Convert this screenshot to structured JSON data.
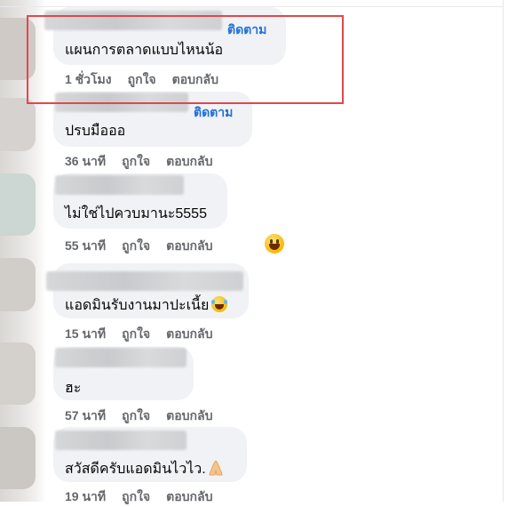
{
  "comments": [
    {
      "follow": "ติดตาม",
      "text": "แผนการตลาดแบบไหนน้อ",
      "time": "1 ชั่วโมง",
      "like": "ถูกใจ",
      "reply": "ตอบกลับ"
    },
    {
      "follow": "ติดตาม",
      "text": "ปรบมือออ",
      "time": "36 นาที",
      "like": "ถูกใจ",
      "reply": "ตอบกลับ"
    },
    {
      "text": "ไม่ใช่ไปควบมานะ5555",
      "time": "55 นาที",
      "like": "ถูกใจ",
      "reply": "ตอบกลับ"
    },
    {
      "text": "แอดมินรับงานมาปะเนี้ย",
      "time": "15 นาที",
      "like": "ถูกใจ",
      "reply": "ตอบกลับ"
    },
    {
      "text": "ฮะ",
      "time": "57 นาที",
      "like": "ถูกใจ",
      "reply": "ตอบกลับ"
    },
    {
      "text": "สวัสดีครับแอดมินไวไว.",
      "time": "19 นาที",
      "like": "ถูกใจ",
      "reply": "ตอบกลับ"
    }
  ],
  "colors": {
    "highlight": "#e0484a",
    "follow_link": "#216fdb",
    "bubble": "#f0f2f5",
    "meta": "#65676b"
  },
  "icons": {
    "reaction_3": "grinning-face-emoji",
    "inline_4": "laughing-tears-emoji",
    "inline_6": "folded-hands-emoji"
  }
}
